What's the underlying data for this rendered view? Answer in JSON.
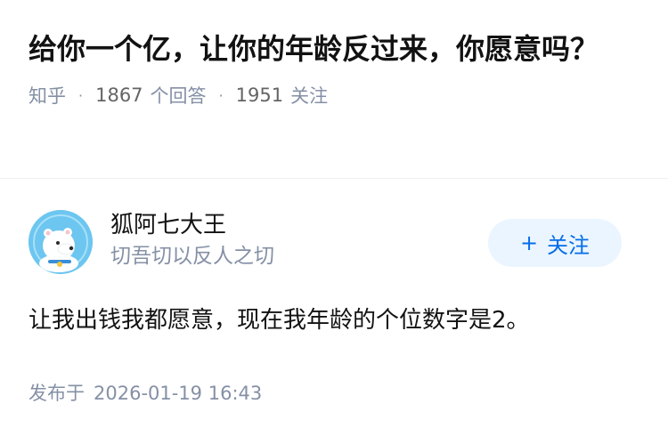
{
  "question": {
    "title": "给你一个亿，让你的年龄反过来，你愿意吗？",
    "source": "知乎",
    "answer_count": "1867",
    "answer_label": "个回答",
    "follower_count": "1951",
    "follower_label": "关注",
    "separator": "·"
  },
  "answer": {
    "author_name": "狐阿七大王",
    "author_bio": "切吾切以反人之切",
    "follow_button": {
      "icon": "plus-icon",
      "symbol": "+",
      "label": "关注"
    },
    "content": "让我出钱我都愿意，现在我年龄的个位数字是2。",
    "publish_label": "发布于",
    "publish_time": "2026-01-19 16:43"
  },
  "colors": {
    "text_primary": "#121212",
    "text_secondary": "#8590a6",
    "accent": "#056de8",
    "button_bg": "#ebf5ff",
    "avatar_bg": "#6cc6f0"
  }
}
